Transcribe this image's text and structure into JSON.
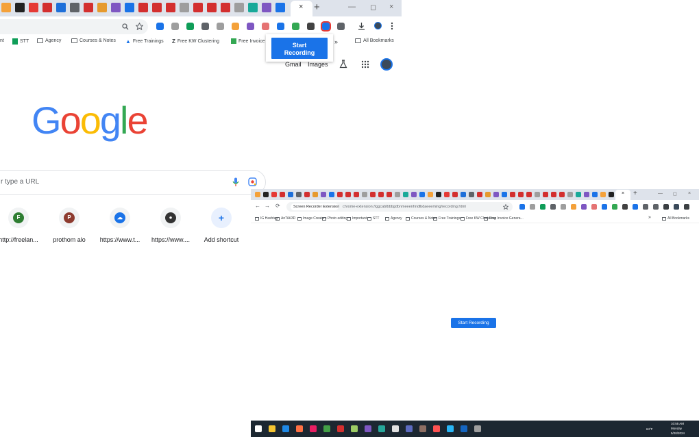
{
  "browser_a": {
    "tab_close": "×",
    "new_tab": "+",
    "window_controls": [
      "—",
      "◻",
      "×"
    ],
    "bookmarks": [
      {
        "label": "STT",
        "icon": "sheets-icon"
      },
      {
        "label": "Agency",
        "icon": "folder-icon"
      },
      {
        "label": "Courses & Notes",
        "icon": "folder-icon"
      },
      {
        "label": "Free Trainings",
        "icon": "drive-icon"
      },
      {
        "label": "Free KW Clustering",
        "icon": "z-icon"
      },
      {
        "label": "Free Invoice I",
        "icon": "invoice-icon"
      },
      {
        "label": "All Bookmarks",
        "icon": "folder-icon"
      }
    ],
    "bookmark_partial_left": "nt",
    "more_bookmarks": "»",
    "popup_button": "Start Recording",
    "google_bar": {
      "gmail": "Gmail",
      "images": "Images"
    },
    "logo_letters": [
      {
        "char": "G",
        "color": "#4285f4"
      },
      {
        "char": "o",
        "color": "#ea4335"
      },
      {
        "char": "o",
        "color": "#fbbc05"
      },
      {
        "char": "g",
        "color": "#4285f4"
      },
      {
        "char": "l",
        "color": "#34a853"
      },
      {
        "char": "e",
        "color": "#ea4335"
      }
    ],
    "search_placeholder": "r type a URL",
    "shortcuts": [
      {
        "label": "http://freelan...",
        "badge": "F",
        "color": "#2e7d32"
      },
      {
        "label": "prothom alo",
        "badge": "P",
        "color": "#8d3b2f"
      },
      {
        "label": "https://www.t...",
        "badge": "☁",
        "color": "#1a73e8"
      },
      {
        "label": "https://www....",
        "badge": "●",
        "color": "#333333"
      },
      {
        "label": "Add shortcut",
        "badge": "+",
        "color": "#1a73e8"
      }
    ]
  },
  "browser_b": {
    "tab_close": "×",
    "new_tab": "+",
    "window_controls": [
      "—",
      "◻",
      "×"
    ],
    "nav": [
      "←",
      "→",
      "⟳"
    ],
    "site_chip": "Screen Recorder Extension",
    "url": "chrome-extension://ggcablbbbgdbnmeeenhndlbdaeeeming/recording.html",
    "bookmarks": [
      "IG Hashtag",
      "AnTiAI3D",
      "Image Creators",
      "Photo editing",
      "Important",
      "STT",
      "Agency",
      "Courses & Notes",
      "Free Trainings",
      "Free KW Clustering",
      "Free Invoice Genera..."
    ],
    "more_bookmarks": "»",
    "all_bookmarks": "All Bookmarks",
    "start_button": "Start Recording"
  },
  "taskbar": {
    "weather": "64°F",
    "time": "10:55 AM",
    "day": "Monday",
    "date": "5/20/2024"
  }
}
